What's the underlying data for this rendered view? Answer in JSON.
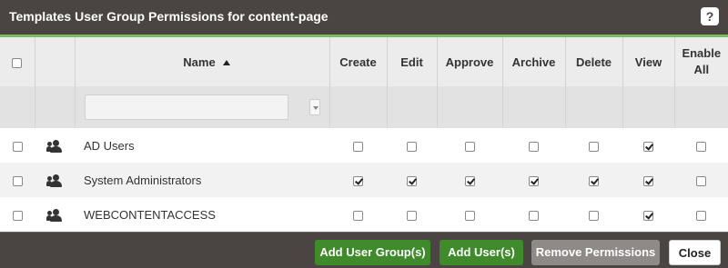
{
  "dialog": {
    "title": "Templates User Group Permissions for content-page",
    "help_label": "?"
  },
  "table": {
    "name_header": "Name",
    "headers": [
      "Create",
      "Edit",
      "Approve",
      "Archive",
      "Delete",
      "View",
      "Enable All"
    ],
    "filter_placeholder": "",
    "rows": [
      {
        "name": "AD Users",
        "perms": [
          false,
          false,
          false,
          false,
          false,
          true,
          false
        ]
      },
      {
        "name": "System Administrators",
        "perms": [
          true,
          true,
          true,
          true,
          true,
          true,
          false
        ]
      },
      {
        "name": "WEBCONTENTACCESS",
        "perms": [
          false,
          false,
          false,
          false,
          false,
          true,
          false
        ]
      }
    ]
  },
  "footer": {
    "add_group_label": "Add User Group(s)",
    "add_user_label": "Add User(s)",
    "remove_label": "Remove Permissions",
    "close_label": "Close"
  },
  "colors": {
    "titlebar": "#4a4542",
    "accent": "#7bbf5a",
    "primary_button": "#3f8b2c",
    "disabled_button": "#8d8a88",
    "link": "#1f5ea8"
  }
}
